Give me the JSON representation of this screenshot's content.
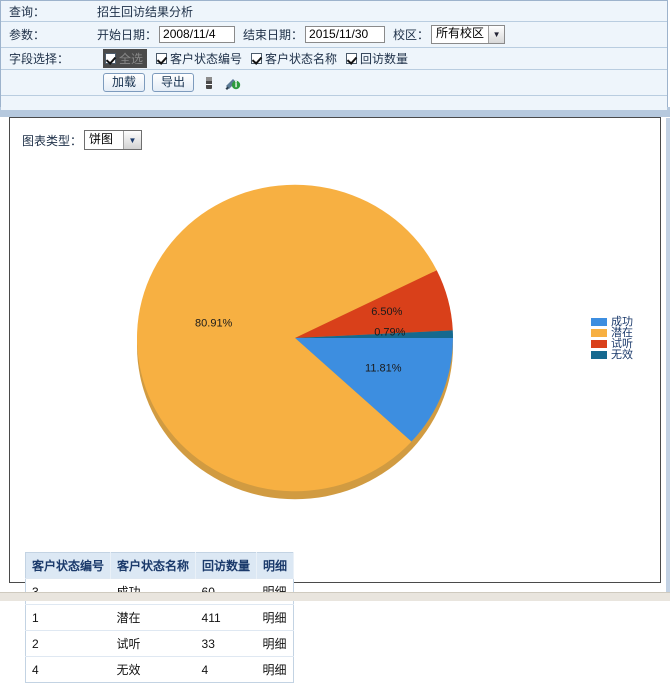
{
  "query_panel": {
    "row_query_label": "查询：",
    "report_title": "招生回访结果分析",
    "row_params_label": "参数：",
    "start_date_label": "开始日期：",
    "start_date_value": "2008/11/4",
    "end_date_label": "结束日期：",
    "end_date_value": "2015/11/30",
    "campus_label": "校区：",
    "campus_value": "所有校区",
    "row_fields_label": "字段选择：",
    "checkboxes": [
      {
        "label": "全选",
        "checked": true,
        "highlighted": true
      },
      {
        "label": "客户状态编号",
        "checked": true,
        "highlighted": false
      },
      {
        "label": "客户状态名称",
        "checked": true,
        "highlighted": false
      },
      {
        "label": "回访数量",
        "checked": true,
        "highlighted": false
      }
    ],
    "buttons": [
      {
        "label": "加载",
        "name": "load-button"
      },
      {
        "label": "导出",
        "name": "export-button"
      }
    ],
    "icons": [
      {
        "name": "print-icon"
      },
      {
        "name": "excel-export-icon"
      }
    ]
  },
  "chart_panel": {
    "chart_type_label": "图表类型：",
    "chart_type_value": "饼图"
  },
  "chart_data": {
    "type": "pie",
    "title": "",
    "categories": [
      "成功",
      "潜在",
      "试听",
      "无效"
    ],
    "values": [
      60,
      411,
      33,
      4
    ],
    "percent_labels": [
      "11.81%",
      "80.91%",
      "6.50%",
      "0.79%"
    ],
    "colors": [
      "#3d8ee0",
      "#f7b042",
      "#d9401a",
      "#15698f"
    ],
    "legend": {
      "position": "right",
      "entries": [
        {
          "label": "成功",
          "color": "#3d8ee0"
        },
        {
          "label": "潜在",
          "color": "#f7b042"
        },
        {
          "label": "试听",
          "color": "#d9401a"
        },
        {
          "label": "无效",
          "color": "#15698f"
        }
      ]
    },
    "slice_order_clockwise_from_3oclock": [
      "成功",
      "潜在",
      "试听",
      "无效"
    ]
  },
  "table": {
    "headers": [
      "客户状态编号",
      "客户状态名称",
      "回访数量",
      "明细"
    ],
    "rows": [
      {
        "code": "3",
        "name": "成功",
        "count": "60",
        "detail": "明细"
      },
      {
        "code": "1",
        "name": "潜在",
        "count": "411",
        "detail": "明细"
      },
      {
        "code": "2",
        "name": "试听",
        "count": "33",
        "detail": "明细"
      },
      {
        "code": "4",
        "name": "无效",
        "count": "4",
        "detail": "明细"
      }
    ]
  }
}
